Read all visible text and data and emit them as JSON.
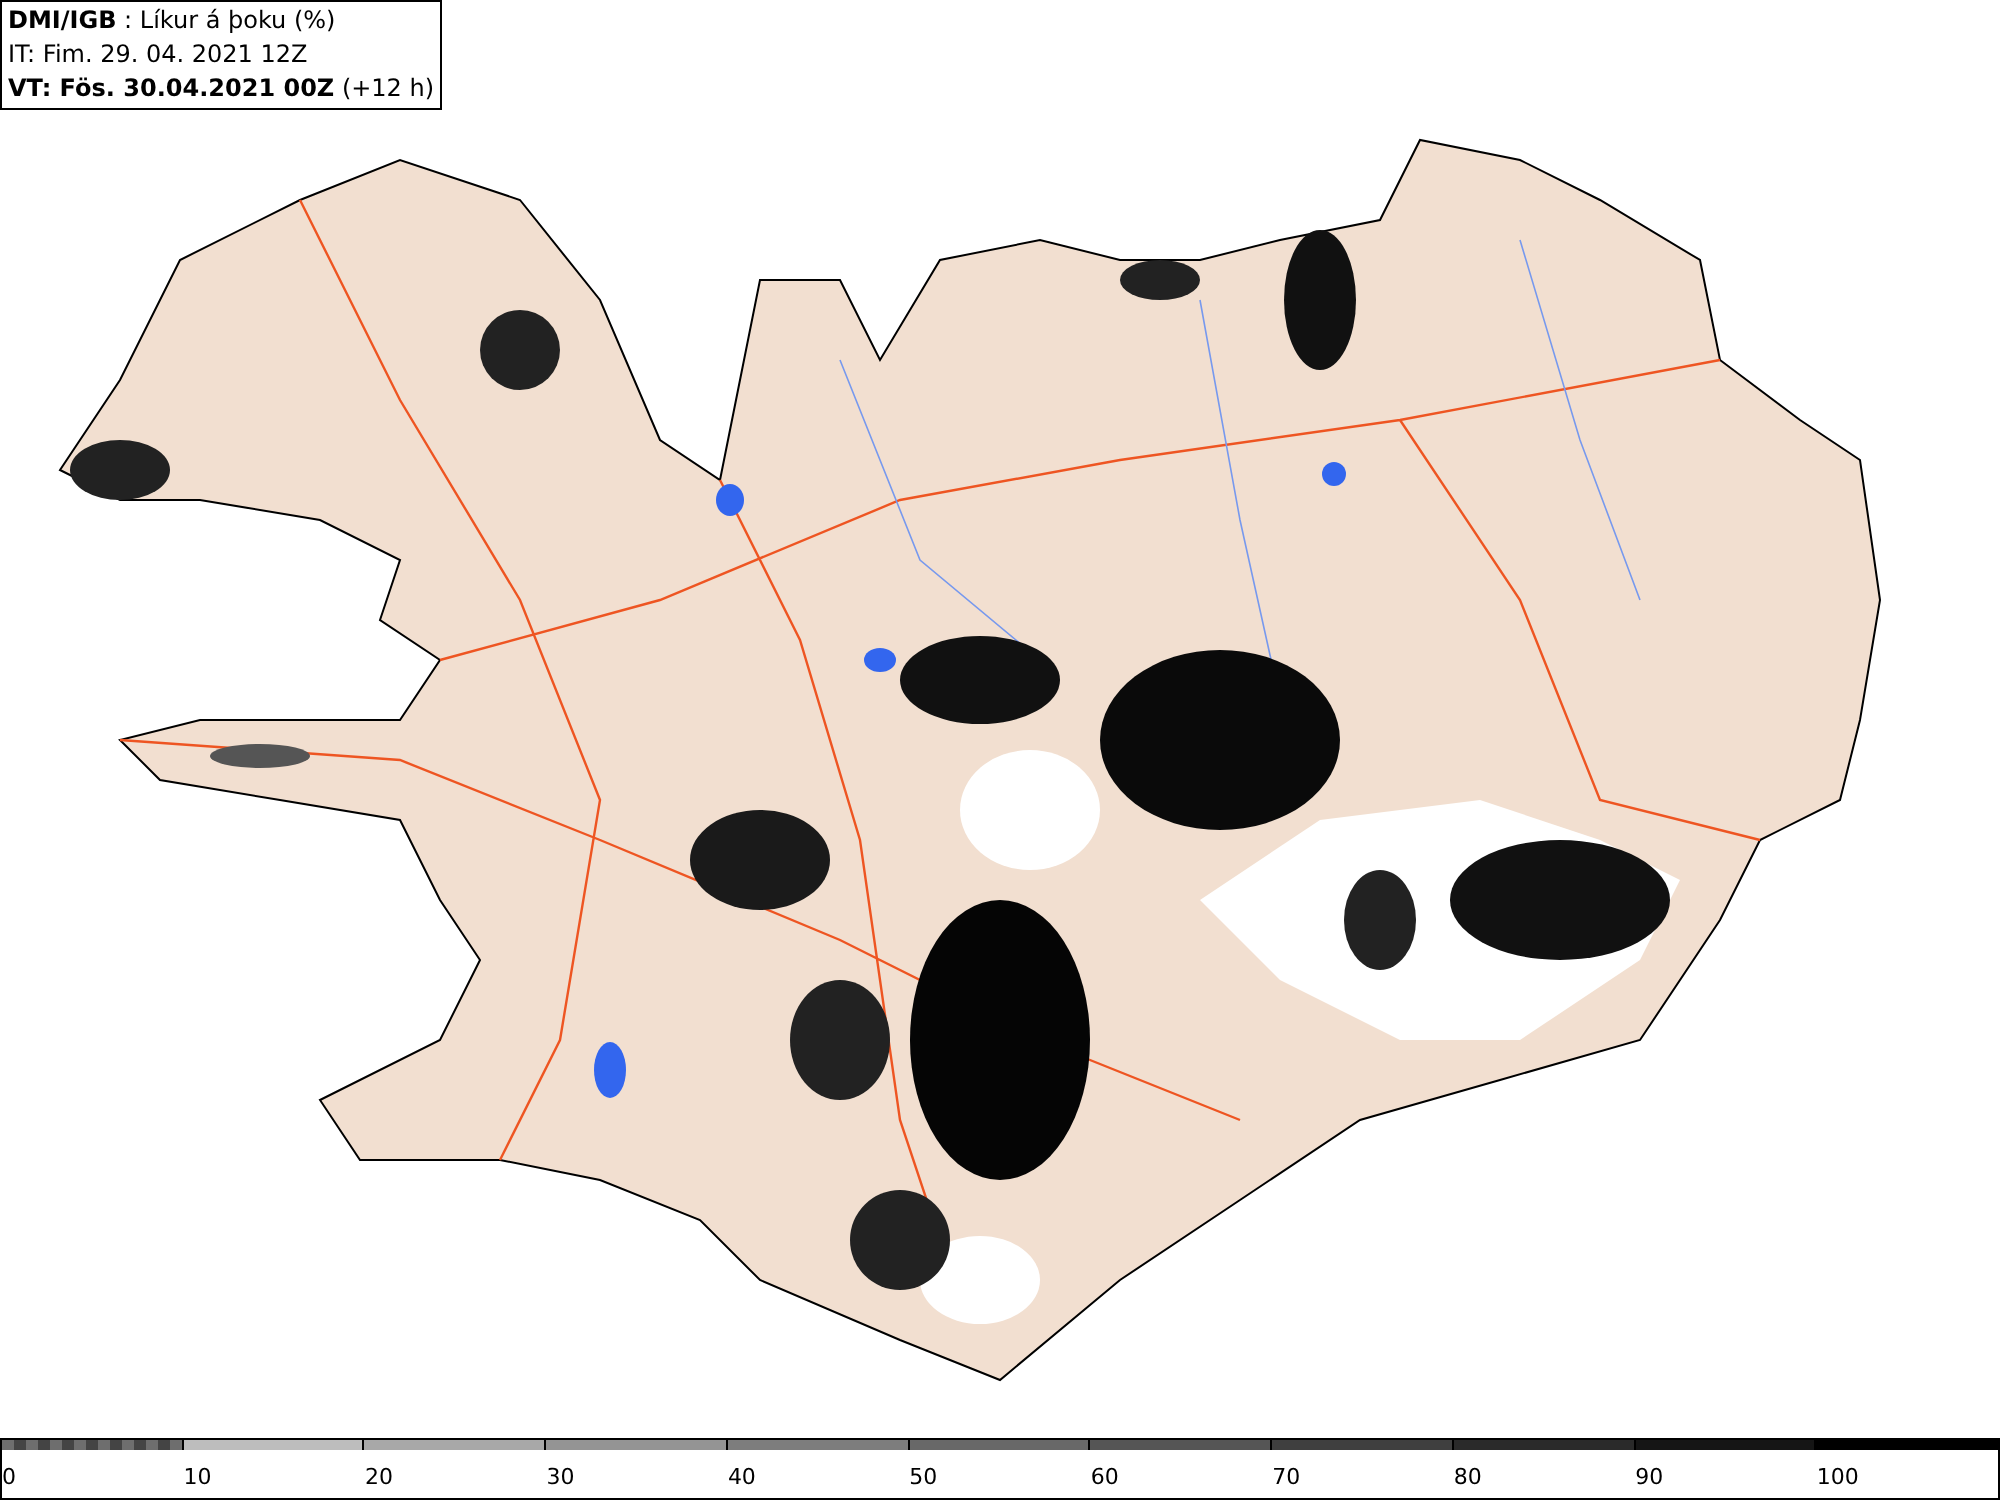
{
  "header": {
    "lines": [
      "**DMI/IGB** : Líkur á þoku (%)",
      "IT: Fim. 29. 04. 2021 12Z",
      "**VT: Fös. 30.04.2021 00Z** (+12 h)"
    ]
  },
  "legend": [
    {
      "label": "0",
      "kind": "checker",
      "color": "#6e6e6e"
    },
    {
      "label": "10",
      "kind": "solid",
      "color": "#bdbdbd"
    },
    {
      "label": "20",
      "kind": "solid",
      "color": "#a8a8a8"
    },
    {
      "label": "30",
      "kind": "solid",
      "color": "#949494"
    },
    {
      "label": "40",
      "kind": "solid",
      "color": "#7d7d7d"
    },
    {
      "label": "50",
      "kind": "solid",
      "color": "#686868"
    },
    {
      "label": "60",
      "kind": "solid",
      "color": "#555555"
    },
    {
      "label": "70",
      "kind": "solid",
      "color": "#3f3f3f"
    },
    {
      "label": "80",
      "kind": "solid",
      "color": "#2a2a2a"
    },
    {
      "label": "90",
      "kind": "solid",
      "color": "#151515"
    },
    {
      "label": "100",
      "kind": "solid",
      "color": "#000000"
    }
  ]
}
